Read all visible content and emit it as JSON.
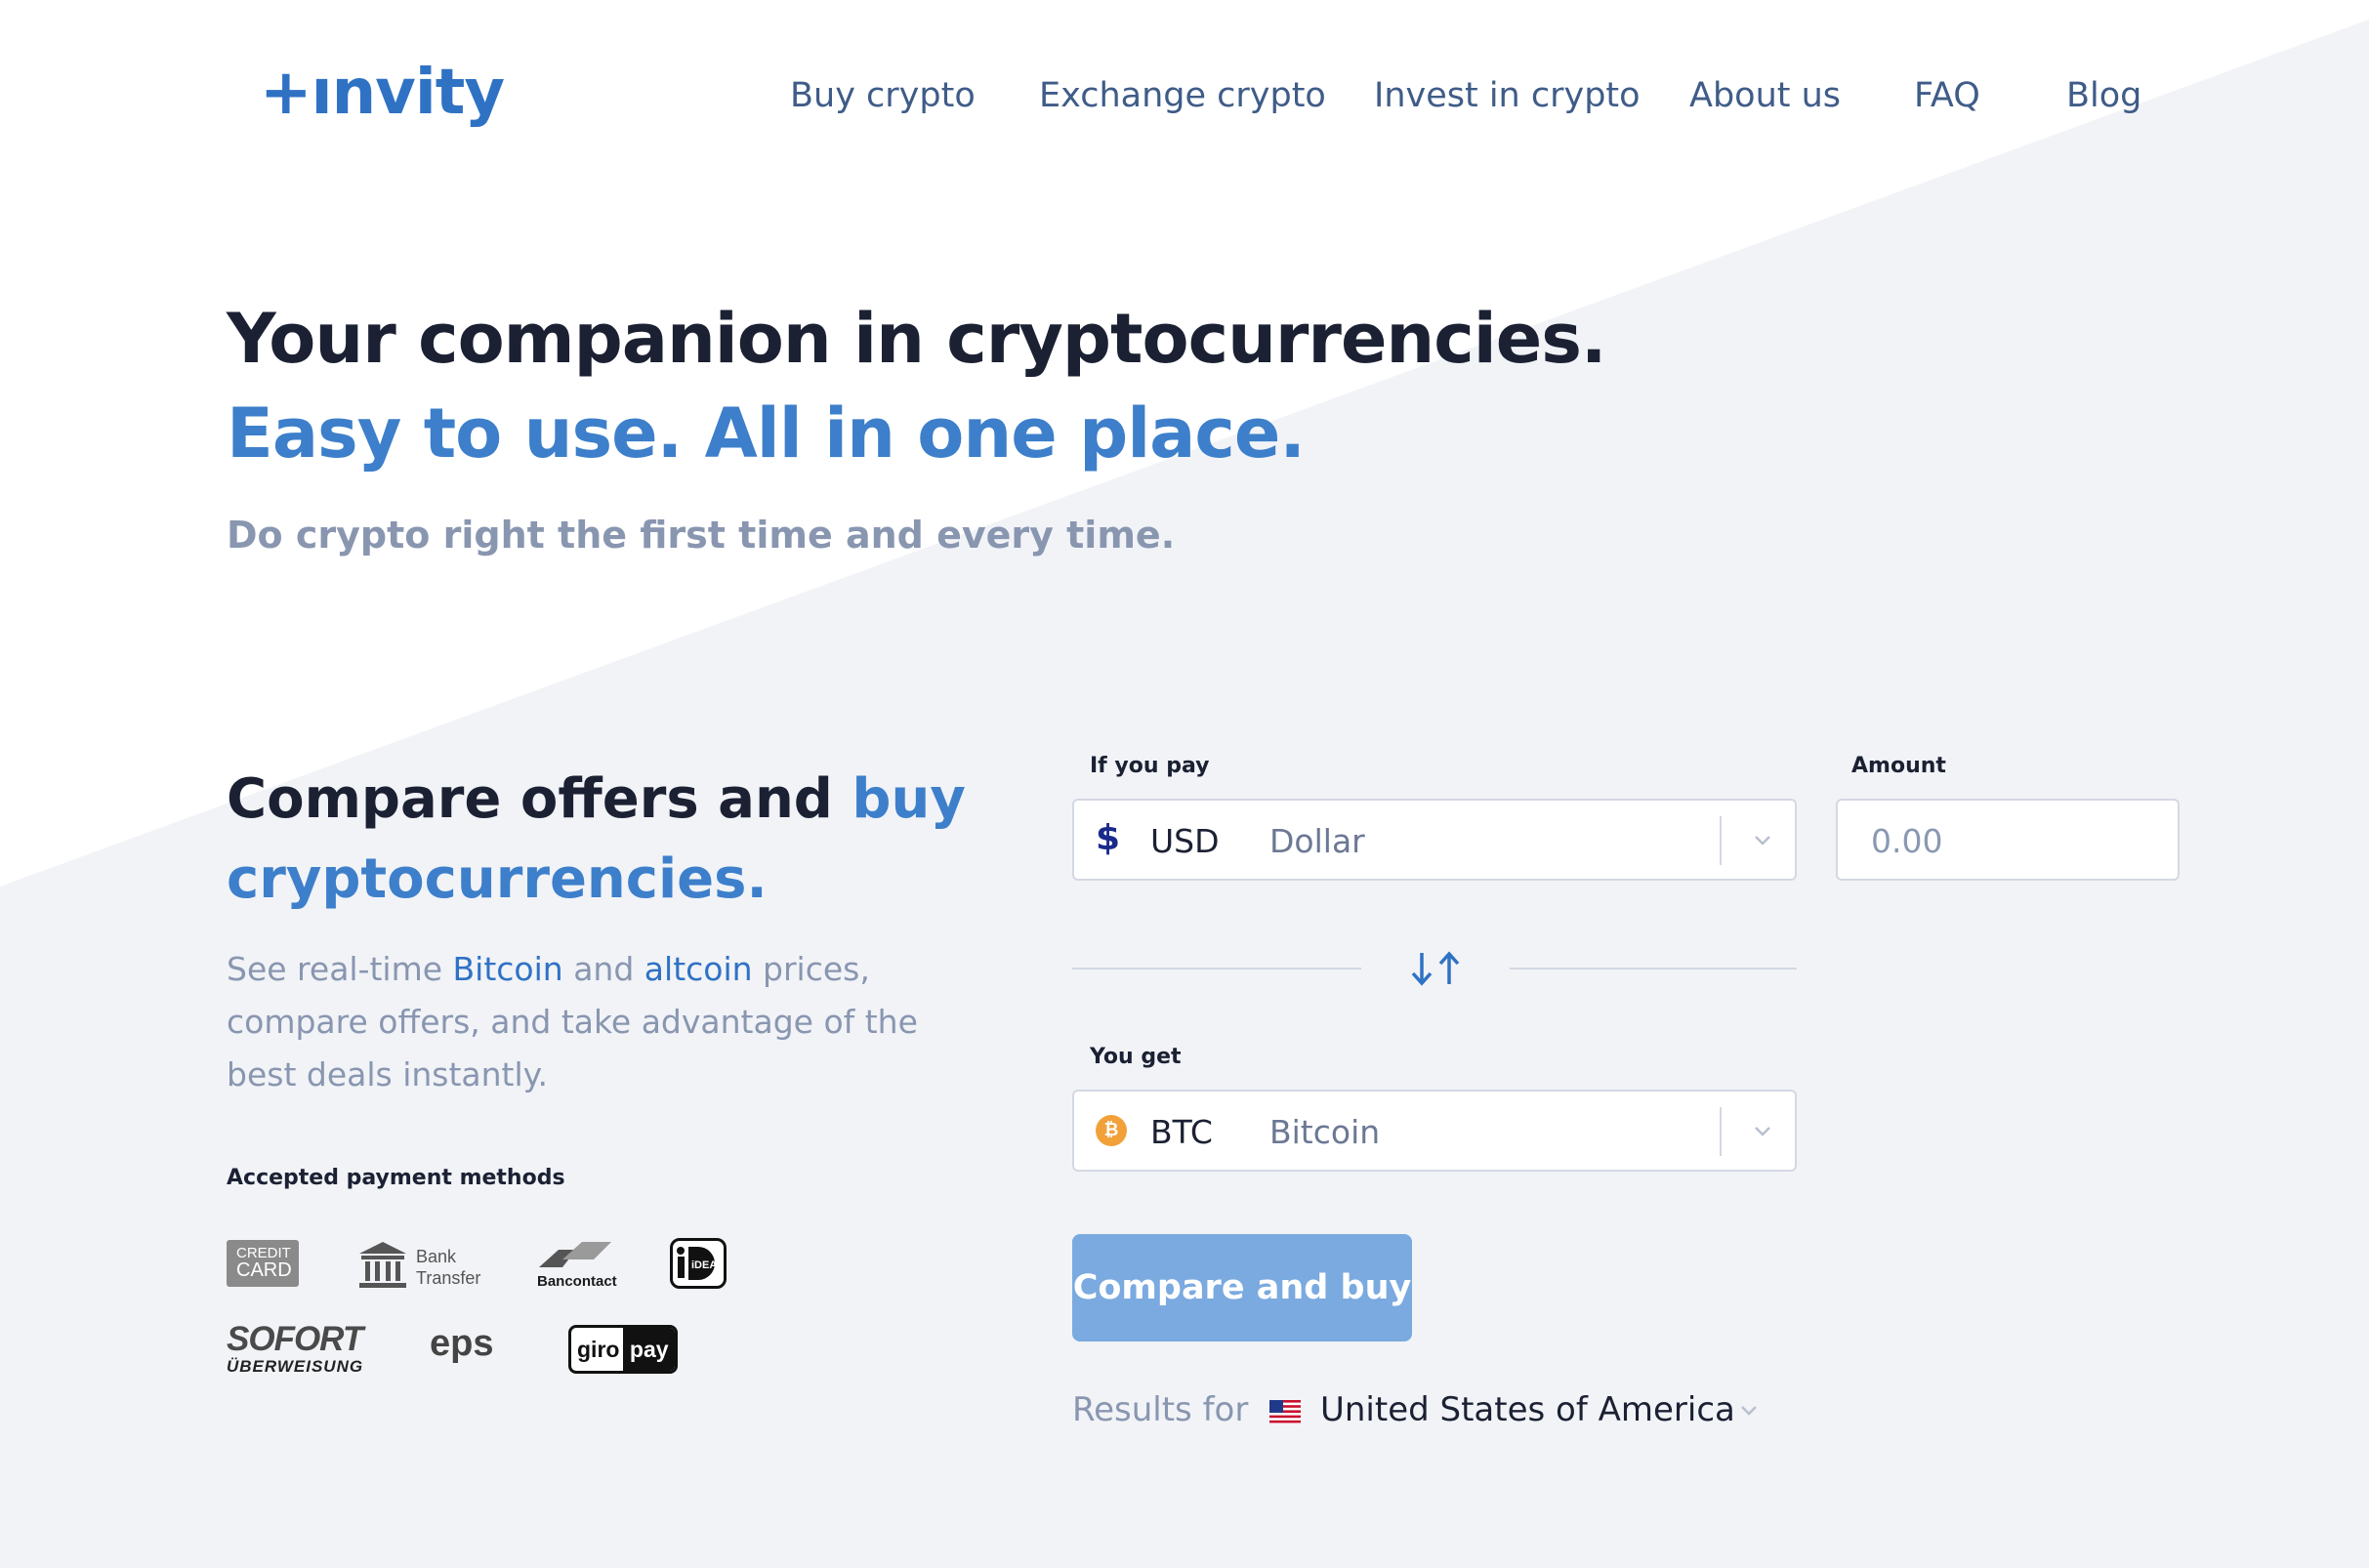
{
  "brand": {
    "logo": "+ınvity"
  },
  "nav": {
    "items": [
      {
        "label": "Buy crypto"
      },
      {
        "label": "Exchange crypto"
      },
      {
        "label": "Invest in crypto"
      },
      {
        "label": "About us"
      },
      {
        "label": "FAQ"
      },
      {
        "label": "Blog"
      }
    ]
  },
  "hero": {
    "title": "Your companion in cryptocurrencies.",
    "tagline": "Easy to use. All in one place.",
    "subtitle": "Do crypto right the first time and every time."
  },
  "compare": {
    "heading_part1": "Compare offers and ",
    "heading_part2": "buy cryptocurrencies.",
    "desc_1": "See real-time ",
    "desc_link1": "Bitcoin",
    "desc_2": " and ",
    "desc_link2": "altcoin",
    "desc_3": " prices, compare offers, and take advantage of the best deals instantly."
  },
  "payment_methods": {
    "title": "Accepted payment methods",
    "credit_card_line1": "CREDIT",
    "credit_card_line2": "CARD",
    "bank_line1": "Bank",
    "bank_line2": "Transfer",
    "bancontact": "Bancontact",
    "ideal": "iDEAL",
    "sofort_line1": "SOFORT",
    "sofort_line2": "ÜBERWEISUNG",
    "eps": "eps",
    "giropay_part1": "giro",
    "giropay_part2": "pay"
  },
  "form": {
    "pay_label": "If you pay",
    "pay_code": "USD",
    "pay_name": "Dollar",
    "pay_symbol": "$",
    "amount_label": "Amount",
    "amount_placeholder": "0.00",
    "get_label": "You get",
    "get_code": "BTC",
    "get_name": "Bitcoin",
    "get_symbol": "₿",
    "cta": "Compare and buy",
    "results_for": "Results for",
    "country": "United States of America"
  },
  "colors": {
    "accent": "#3d7fca",
    "cta": "#7aaadf",
    "background": "#f1f3f7",
    "bitcoin": "#f2a13a"
  }
}
